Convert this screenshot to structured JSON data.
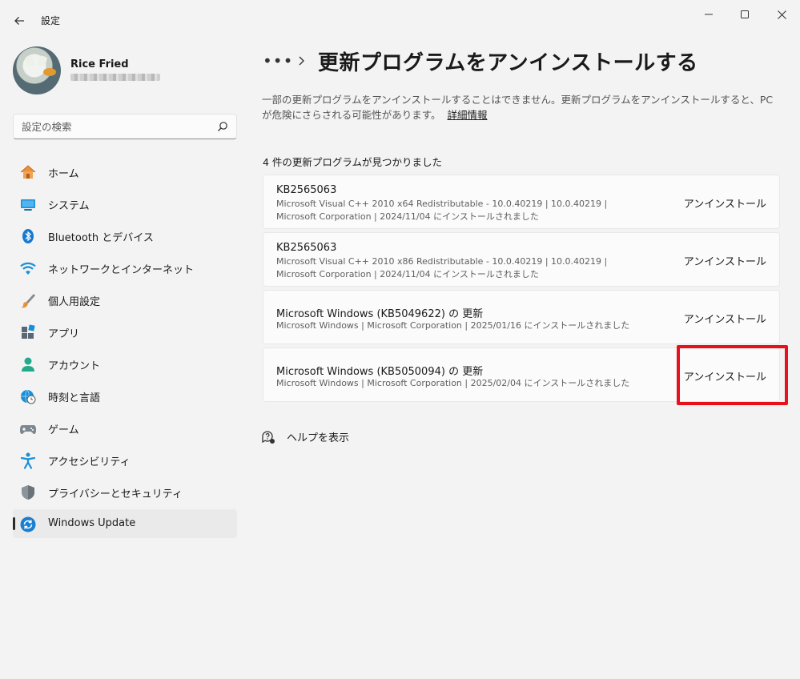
{
  "window": {
    "title": "設定"
  },
  "profile": {
    "name": "Rice Fried",
    "email": "redacted-email"
  },
  "search": {
    "placeholder": "設定の検索"
  },
  "sidebar": {
    "items": [
      {
        "label": "ホーム",
        "icon": "home-icon"
      },
      {
        "label": "システム",
        "icon": "system-icon"
      },
      {
        "label": "Bluetooth とデバイス",
        "icon": "bluetooth-icon"
      },
      {
        "label": "ネットワークとインターネット",
        "icon": "wifi-icon"
      },
      {
        "label": "個人用設定",
        "icon": "brush-icon"
      },
      {
        "label": "アプリ",
        "icon": "apps-icon"
      },
      {
        "label": "アカウント",
        "icon": "account-icon"
      },
      {
        "label": "時刻と言語",
        "icon": "globe-clock-icon"
      },
      {
        "label": "ゲーム",
        "icon": "gamepad-icon"
      },
      {
        "label": "アクセシビリティ",
        "icon": "accessibility-icon"
      },
      {
        "label": "プライバシーとセキュリティ",
        "icon": "shield-icon"
      },
      {
        "label": "Windows Update",
        "icon": "update-icon",
        "active": true
      }
    ]
  },
  "main": {
    "breadcrumb_more": "•••",
    "title": "更新プログラムをアンインストールする",
    "description": "一部の更新プログラムをアンインストールすることはできません。更新プログラムをアンインストールすると、PC が危険にさらされる可能性があります。",
    "details_link": "詳細情報",
    "count_label": "4 件の更新プログラムが見つかりました",
    "updates": [
      {
        "title": "KB2565063",
        "meta_line1": "Microsoft Visual C++ 2010  x64 Redistributable - 10.0.40219   |   10.0.40219   |",
        "meta_line2": "Microsoft Corporation   |   2024/11/04 にインストールされました",
        "button": "アンインストール"
      },
      {
        "title": "KB2565063",
        "meta_line1": "Microsoft Visual C++ 2010  x86 Redistributable - 10.0.40219   |   10.0.40219   |",
        "meta_line2": "Microsoft Corporation   |   2024/11/04 にインストールされました",
        "button": "アンインストール"
      },
      {
        "title": "Microsoft Windows (KB5049622) の 更新",
        "meta_line1": "Microsoft Windows   |   Microsoft Corporation   |   2025/01/16 にインストールされました",
        "meta_line2": "",
        "button": "アンインストール"
      },
      {
        "title": "Microsoft Windows (KB5050094) の 更新",
        "meta_line1": "Microsoft Windows   |   Microsoft Corporation   |   2025/02/04 にインストールされました",
        "meta_line2": "",
        "button": "アンインストール"
      }
    ],
    "help_label": "ヘルプを表示"
  },
  "colors": {
    "highlight": "#e8101a",
    "accent": "#0067c0"
  }
}
